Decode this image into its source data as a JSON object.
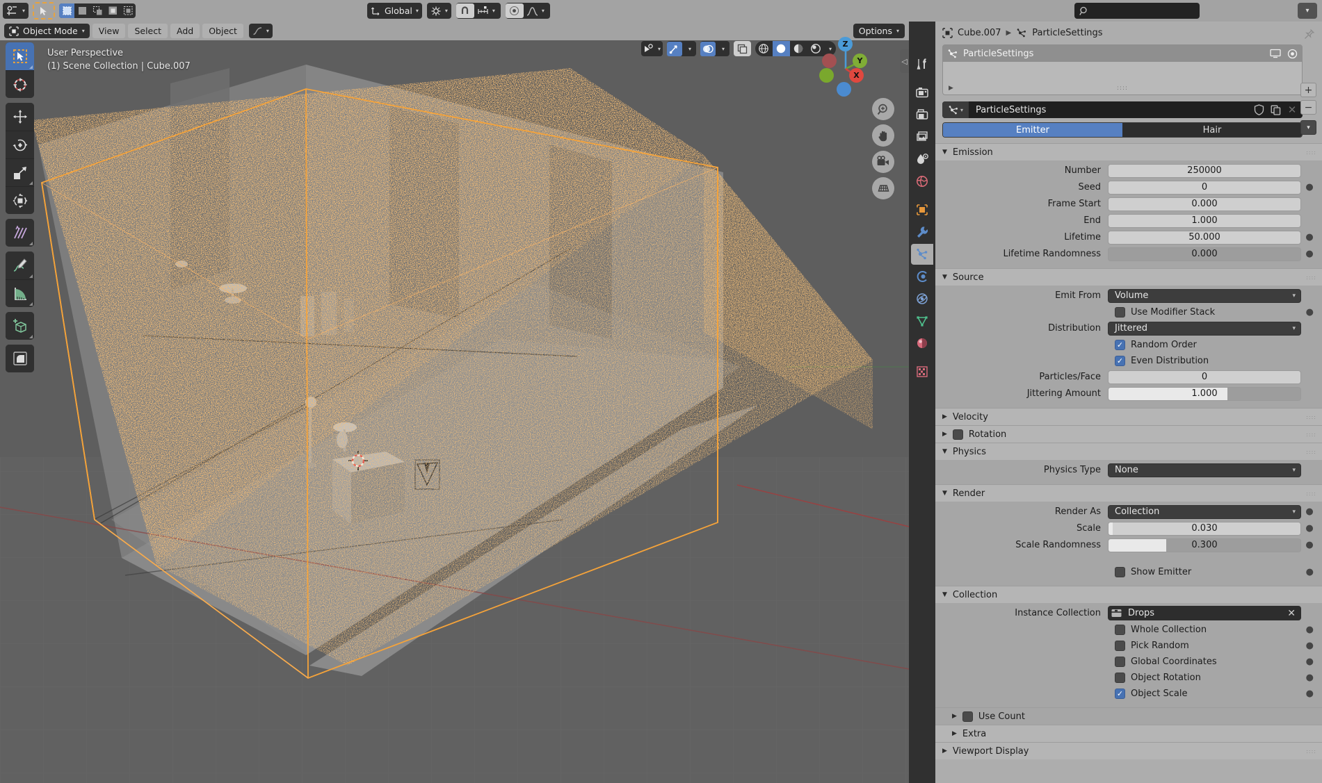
{
  "topbar": {
    "editor_type_icon": "editor-type-icon",
    "search_placeholder": "",
    "transform_orientation": "Global",
    "snap_icon": "snap-magnet-icon",
    "proportional_icon": "proportional-edit-icon",
    "options_label": "Options"
  },
  "viewport": {
    "mode": "Object Mode",
    "menus": [
      "View",
      "Select",
      "Add",
      "Object"
    ],
    "overlay_text_line1": "User Perspective",
    "overlay_text_line2": "(1) Scene Collection | Cube.007",
    "gizmo_axes": [
      "X",
      "Y",
      "Z"
    ],
    "nav_buttons": [
      "zoom-icon",
      "pan-hand-icon",
      "camera-icon",
      "ortho-grid-icon"
    ],
    "tools": [
      "tweak-select-box-tool",
      "cursor-tool",
      "move-tool",
      "rotate-tool",
      "scale-tool",
      "transform-tool",
      "annotate-tool",
      "measure-tool",
      "add-cube-tool",
      "bevel-tool"
    ],
    "shading_modes": [
      "wireframe",
      "solid",
      "material-preview",
      "rendered"
    ],
    "active_shading": "solid"
  },
  "properties": {
    "breadcrumb": {
      "object": "Cube.007",
      "datablock": "ParticleSettings"
    },
    "particle_system_list": {
      "item_name": "ParticleSettings",
      "render_toggle_icon": "monitor-icon",
      "viewport_toggle_icon": "camera-render-icon",
      "add_label": "+",
      "remove_label": "−"
    },
    "datablock": {
      "name": "ParticleSettings",
      "shield_icon": "fake-user-shield-icon",
      "copy_icon": "duplicate-icon",
      "close_icon": "unlink-icon"
    },
    "type_tabs": [
      {
        "label": "Emitter",
        "active": true
      },
      {
        "label": "Hair",
        "active": false
      }
    ],
    "tabs": [
      "tool-icon",
      "render-icon",
      "output-icon",
      "view-layer-icon",
      "scene-icon",
      "world-icon",
      "object-icon",
      "modifier-wrench-icon",
      "particles-icon",
      "physics-icon",
      "constraints-icon",
      "data-mesh-icon",
      "material-icon",
      "texture-icon"
    ],
    "active_tab": "particles-icon",
    "panels": {
      "emission": {
        "title": "Emission",
        "expanded": true,
        "fields": [
          {
            "label": "Number",
            "value": "250000",
            "type": "number",
            "anim_dot": false
          },
          {
            "label": "Seed",
            "value": "0",
            "type": "number",
            "anim_dot": true
          },
          {
            "label": "Frame Start",
            "value": "0.000",
            "type": "number",
            "anim_dot": false
          },
          {
            "label": "End",
            "value": "1.000",
            "type": "number",
            "anim_dot": false
          },
          {
            "label": "Lifetime",
            "value": "50.000",
            "type": "number",
            "anim_dot": true
          },
          {
            "label": "Lifetime Randomness",
            "value": "0.000",
            "type": "slider",
            "fill": 0,
            "anim_dot": true
          }
        ]
      },
      "source": {
        "title": "Source",
        "expanded": true,
        "emit_from": {
          "label": "Emit From",
          "value": "Volume"
        },
        "use_modifier_stack": {
          "label": "Use Modifier Stack",
          "checked": false,
          "anim_dot": true
        },
        "distribution": {
          "label": "Distribution",
          "value": "Jittered"
        },
        "random_order": {
          "label": "Random Order",
          "checked": true
        },
        "even_distribution": {
          "label": "Even Distribution",
          "checked": true
        },
        "particles_face": {
          "label": "Particles/Face",
          "value": "0"
        },
        "jittering_amount": {
          "label": "Jittering Amount",
          "value": "1.000",
          "fill": 62
        }
      },
      "velocity": {
        "title": "Velocity",
        "expanded": false
      },
      "rotation": {
        "title": "Rotation",
        "expanded": false,
        "checked": false
      },
      "physics": {
        "title": "Physics",
        "expanded": true,
        "physics_type": {
          "label": "Physics Type",
          "value": "None"
        }
      },
      "render": {
        "title": "Render",
        "expanded": true,
        "render_as": {
          "label": "Render As",
          "value": "Collection",
          "anim_dot": true
        },
        "scale": {
          "label": "Scale",
          "value": "0.030",
          "fill": 2,
          "anim_dot": true
        },
        "scale_randomness": {
          "label": "Scale Randomness",
          "value": "0.300",
          "fill": 30,
          "anim_dot": true
        },
        "show_emitter": {
          "label": "Show Emitter",
          "checked": false,
          "anim_dot": true
        }
      },
      "collection": {
        "title": "Collection",
        "expanded": true,
        "instance_collection": {
          "label": "Instance Collection",
          "value": "Drops"
        },
        "checkboxes": [
          {
            "label": "Whole Collection",
            "checked": false,
            "anim_dot": true
          },
          {
            "label": "Pick Random",
            "checked": false,
            "anim_dot": true
          },
          {
            "label": "Global Coordinates",
            "checked": false,
            "anim_dot": true
          },
          {
            "label": "Object Rotation",
            "checked": false,
            "anim_dot": true
          },
          {
            "label": "Object Scale",
            "checked": true,
            "anim_dot": true
          }
        ]
      },
      "use_count": {
        "title": "Use Count",
        "expanded": false,
        "checked": false
      },
      "extra": {
        "title": "Extra",
        "expanded": false
      },
      "viewport_display": {
        "title": "Viewport Display",
        "expanded": false
      }
    }
  }
}
